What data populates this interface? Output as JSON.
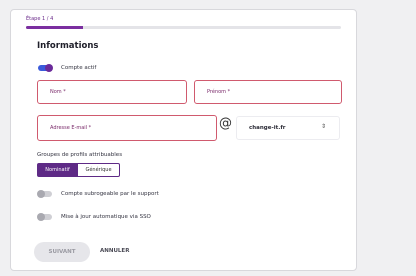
{
  "stepper": {
    "label": "Étape 1 / 4",
    "progress": 0.18
  },
  "form": {
    "title": "Informations",
    "active_toggle": {
      "label": "Compte actif",
      "on": true
    },
    "fields": {
      "nom": "Nom *",
      "prenom": "Prénom *",
      "email": "Adresse E-mail *"
    },
    "at_symbol": "@",
    "domain_select": {
      "value": "change-it.fr",
      "chevron": "⇕"
    },
    "groups": {
      "label": "Groupes de profils attribuables",
      "options": [
        "Nominatif",
        "Générique"
      ],
      "selected": "Nominatif"
    },
    "subrogation_toggle": {
      "label": "Compte subrogeable par le support",
      "on": false
    },
    "sso_toggle": {
      "label": "Mise à jour automatique via SSO",
      "on": false
    }
  },
  "actions": {
    "next": "SUIVANT",
    "cancel": "ANNULER"
  },
  "colors": {
    "accent": "#5e2a86",
    "error": "#d05a6e",
    "toggle_on": "#3b5bdb"
  }
}
